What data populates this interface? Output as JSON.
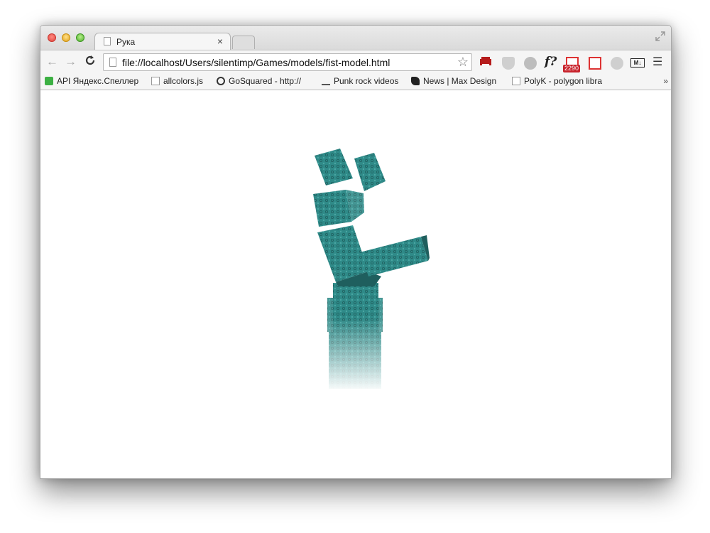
{
  "window": {
    "tab": {
      "title": "Рука",
      "close": "×"
    }
  },
  "toolbar": {
    "back": "←",
    "forward": "→",
    "reload": "C",
    "url": "file://localhost/Users/silentimp/Games/models/fist-model.html",
    "star": "☆",
    "extensions": {
      "sofa_icon": "sofa-icon",
      "script_font": "f?",
      "gmail_badge": "2290",
      "markdown_label": "M↓",
      "menu": "☰"
    }
  },
  "bookmarks": {
    "items": [
      {
        "label": "API Яндекс.Спеллер",
        "icon": "green-speller-icon"
      },
      {
        "label": "allcolors.js",
        "icon": "page-icon"
      },
      {
        "label": "GoSquared - http://",
        "icon": "gosquared-icon"
      },
      {
        "label": "Punk rock videos",
        "icon": "video-icon"
      },
      {
        "label": "News | Max Design",
        "icon": "max-design-icon"
      },
      {
        "label": "PolyK - polygon libra",
        "icon": "page-icon"
      }
    ],
    "more": "»"
  },
  "colors": {
    "cube_face": "#2f8a88",
    "cube_dark": "#1f5f5e",
    "cube_light": "#4aa6a3"
  }
}
